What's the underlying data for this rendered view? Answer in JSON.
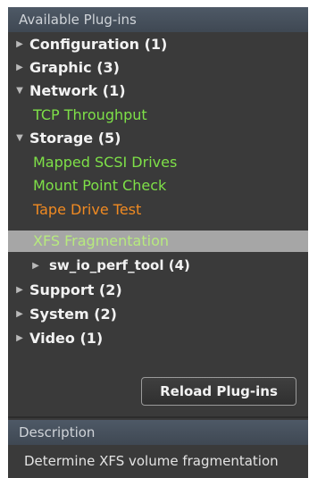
{
  "panel": {
    "title": "Available Plug-ins"
  },
  "tree": {
    "configuration": "Configuration (1)",
    "graphic": "Graphic (3)",
    "network": "Network (1)",
    "tcp_throughput": "TCP Throughput",
    "storage": "Storage (5)",
    "mapped_scsi": "Mapped SCSI Drives",
    "mount_point": "Mount Point Check",
    "tape_drive": "Tape Drive Test",
    "xfs_frag": "XFS Fragmentation",
    "sw_io": "sw_io_perf_tool (4)",
    "support": "Support (2)",
    "system": "System (2)",
    "video": "Video (1)"
  },
  "colors": {
    "available_plugin": "#7ee048",
    "warning_plugin": "#f08a22",
    "selected_row": "#a6a6a6"
  },
  "icons": {
    "collapsed": "triangle-right-icon",
    "expanded": "triangle-down-icon"
  },
  "buttons": {
    "reload": "Reload Plug-ins"
  },
  "description": {
    "title": "Description",
    "text": "Determine XFS volume fragmentation"
  }
}
